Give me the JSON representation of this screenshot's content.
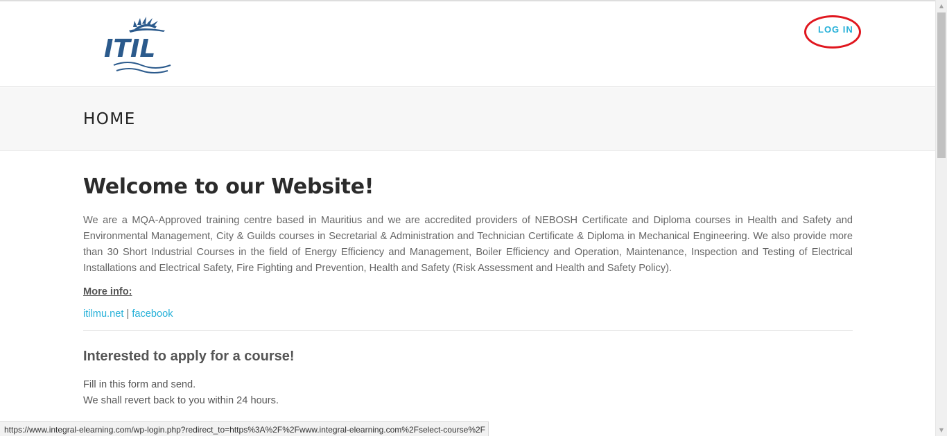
{
  "header": {
    "logo_text": "ITIL",
    "login_label": "LOG IN"
  },
  "page": {
    "title": "HOME"
  },
  "main": {
    "welcome_heading": "Welcome to our Website!",
    "intro_paragraph": "We are a MQA-Approved training centre based in Mauritius and we are accredited providers of NEBOSH Certificate and Diploma courses in Health and Safety and Environmental Management, City & Guilds courses in Secretarial & Administration and Technician Certificate & Diploma in Mechanical Engineering. We also provide more than 30 Short Industrial Courses in the field of Energy Efficiency and Management, Boiler Efficiency and Operation, Maintenance, Inspection and Testing of Electrical Installations and Electrical Safety, Fire Fighting and Prevention, Health and Safety (Risk Assessment and Health and Safety Policy).",
    "more_info_label": "More info:",
    "links": {
      "website": "itilmu.net",
      "separator": "|",
      "facebook": "facebook"
    },
    "apply_heading": "Interested to apply for a course!",
    "form_line_1": "Fill in this form and send.",
    "form_line_2": "We shall revert back to you within 24 hours."
  },
  "status_bar": {
    "url": "https://www.integral-elearning.com/wp-login.php?redirect_to=https%3A%2F%2Fwww.integral-elearning.com%2Fselect-course%2F"
  },
  "colors": {
    "accent": "#25b0d8",
    "highlight_circle": "#e0161e",
    "logo_blue": "#2b5a8c"
  }
}
